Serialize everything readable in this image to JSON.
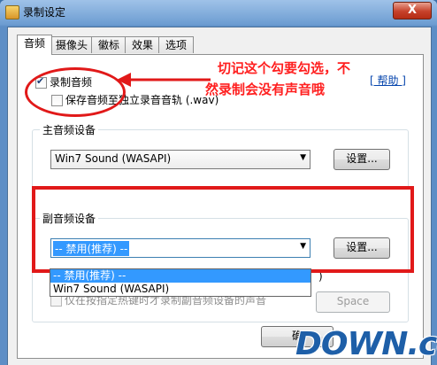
{
  "window": {
    "title": "录制设定",
    "close": "X"
  },
  "tabs": [
    "音频",
    "摄像头",
    "徽标",
    "效果",
    "选项"
  ],
  "audio": {
    "record_audio": "录制音频",
    "save_separate": "保存音频至独立录音音轨 (.wav)",
    "help": "[ 帮助 ]",
    "main_group": "主音频设备",
    "main_device": "Win7 Sound (WASAPI)",
    "settings": "设置...",
    "secondary_group": "副音频设备",
    "secondary_device": "-- 禁用(推荐) --",
    "dropdown_options": [
      "-- 禁用(推荐) --",
      "Win7 Sound (WASAPI)"
    ],
    "hotkey_only": "仅在按指定热键时才录制副音频设备的声音",
    "hotkey_value": "Space",
    "ok_partial": "确",
    "partial_paren": ")"
  },
  "annotation": {
    "line1": "切记这个勾要勾选，不",
    "line2": "然录制会没有声音哦",
    "color": "#e11919"
  },
  "watermark": {
    "text": "DOWN.cc"
  }
}
